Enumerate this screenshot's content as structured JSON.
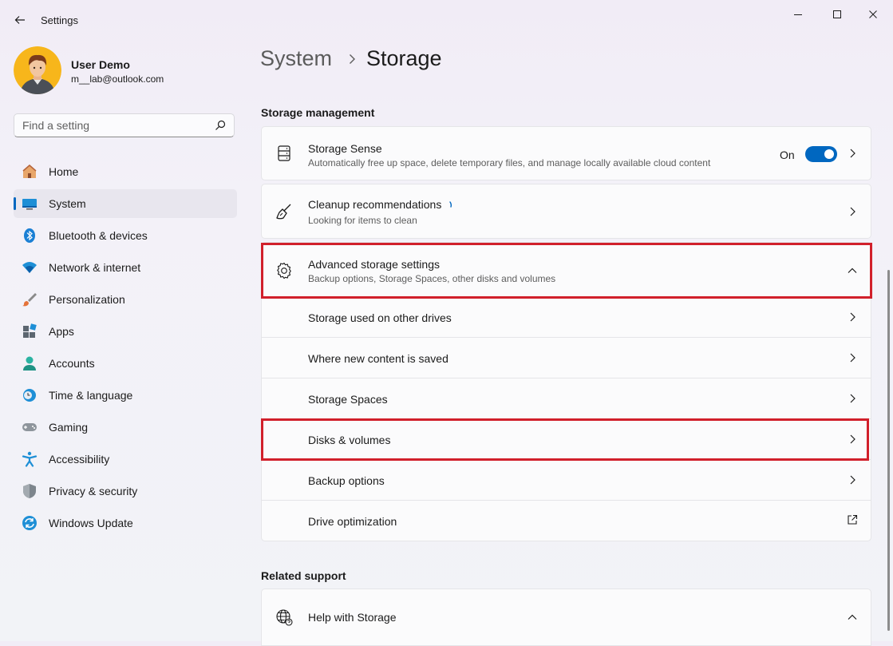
{
  "window": {
    "title": "Settings"
  },
  "user": {
    "name": "User Demo",
    "email": "m__lab@outlook.com"
  },
  "search": {
    "placeholder": "Find a setting"
  },
  "nav": {
    "items": [
      {
        "label": "Home",
        "icon": "home-icon"
      },
      {
        "label": "System",
        "icon": "monitor-icon",
        "selected": true
      },
      {
        "label": "Bluetooth & devices",
        "icon": "bluetooth-icon"
      },
      {
        "label": "Network & internet",
        "icon": "wifi-icon"
      },
      {
        "label": "Personalization",
        "icon": "brush-icon"
      },
      {
        "label": "Apps",
        "icon": "apps-icon"
      },
      {
        "label": "Accounts",
        "icon": "person-icon"
      },
      {
        "label": "Time & language",
        "icon": "clock-globe-icon"
      },
      {
        "label": "Gaming",
        "icon": "gamepad-icon"
      },
      {
        "label": "Accessibility",
        "icon": "accessibility-icon"
      },
      {
        "label": "Privacy & security",
        "icon": "shield-icon"
      },
      {
        "label": "Windows Update",
        "icon": "update-icon"
      }
    ]
  },
  "breadcrumb": {
    "parent": "System",
    "current": "Storage"
  },
  "storage_management": {
    "heading": "Storage management",
    "storage_sense": {
      "title": "Storage Sense",
      "description": "Automatically free up space, delete temporary files, and manage locally available cloud content",
      "toggle_label": "On",
      "toggle_on": true
    },
    "cleanup": {
      "title": "Cleanup recommendations",
      "description": "Looking for items to clean"
    },
    "advanced": {
      "title": "Advanced storage settings",
      "description": "Backup options, Storage Spaces, other disks and volumes",
      "expanded": true,
      "items": [
        {
          "label": "Storage used on other drives",
          "action": "chevron"
        },
        {
          "label": "Where new content is saved",
          "action": "chevron"
        },
        {
          "label": "Storage Spaces",
          "action": "chevron"
        },
        {
          "label": "Disks & volumes",
          "action": "chevron"
        },
        {
          "label": "Backup options",
          "action": "chevron"
        },
        {
          "label": "Drive optimization",
          "action": "external-link"
        }
      ]
    }
  },
  "related_support": {
    "heading": "Related support",
    "help": {
      "title": "Help with Storage"
    }
  },
  "colors": {
    "accent": "#0067c0",
    "highlight": "#d1202b"
  }
}
